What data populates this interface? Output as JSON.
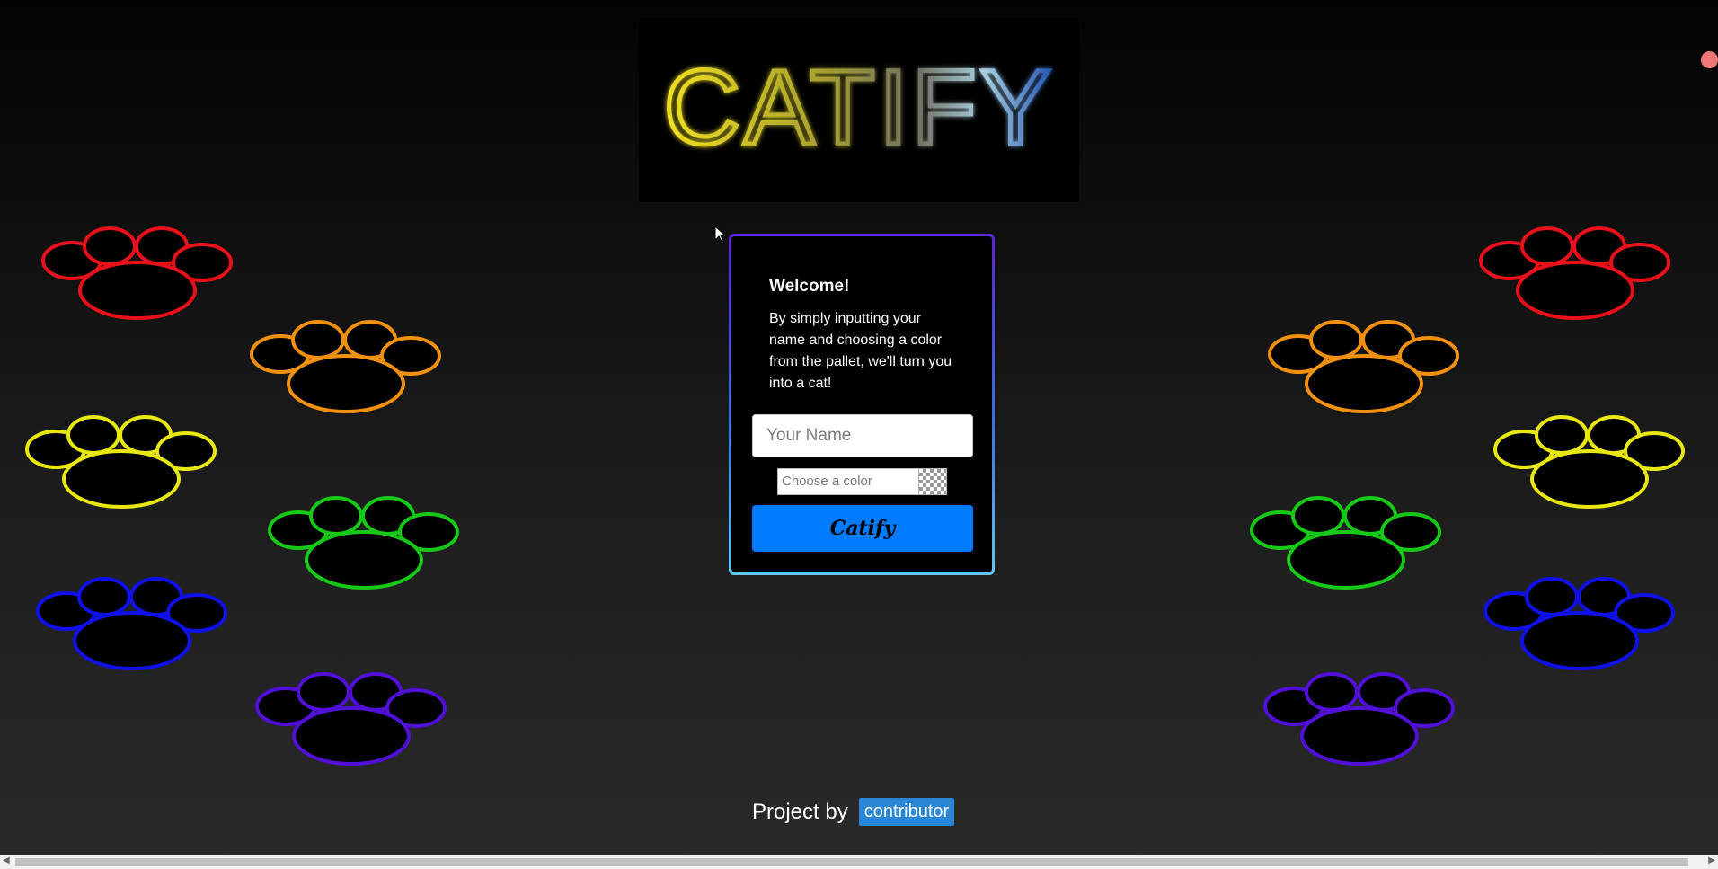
{
  "logo": {
    "text": "CATIFY"
  },
  "card": {
    "title": "Welcome!",
    "description": "By simply inputting your name and choosing a color from the pallet, we'll turn you into a cat!",
    "name_placeholder": "Your Name",
    "color_placeholder": "Choose a color",
    "button_label": "Catify"
  },
  "footer": {
    "text": "Project by",
    "link_label": "contributor"
  },
  "paws": {
    "colors": [
      "#e8101a",
      "#f09010",
      "#e8e810",
      "#18c818",
      "#1010e8",
      "#5010d8"
    ]
  },
  "colors": {
    "primary_button": "#007bff",
    "link_badge": "#2a87d6"
  }
}
